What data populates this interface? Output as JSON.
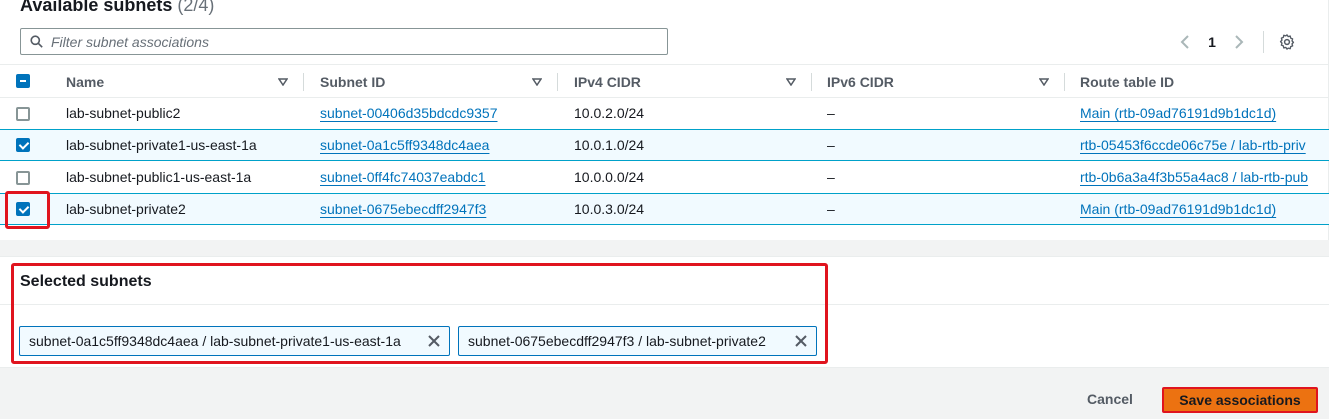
{
  "header": {
    "title": "Available subnets",
    "count": "(2/4)"
  },
  "filter": {
    "placeholder": "Filter subnet associations",
    "value": ""
  },
  "pagination": {
    "current_page": "1"
  },
  "columns": {
    "name": "Name",
    "subnet_id": "Subnet ID",
    "ipv4": "IPv4 CIDR",
    "ipv6": "IPv6 CIDR",
    "route_table": "Route table ID"
  },
  "rows": [
    {
      "name": "lab-subnet-public2",
      "subnet_id": "subnet-00406d35bdcdc9357",
      "ipv4": "10.0.2.0/24",
      "ipv6": "–",
      "route_table": "Main (rtb-09ad76191d9b1dc1d)",
      "selected": false
    },
    {
      "name": "lab-subnet-private1-us-east-1a",
      "subnet_id": "subnet-0a1c5ff9348dc4aea",
      "ipv4": "10.0.1.0/24",
      "ipv6": "–",
      "route_table": "rtb-05453f6ccde06c75e / lab-rtb-priv",
      "selected": true
    },
    {
      "name": "lab-subnet-public1-us-east-1a",
      "subnet_id": "subnet-0ff4fc74037eabdc1",
      "ipv4": "10.0.0.0/24",
      "ipv6": "–",
      "route_table": "rtb-0b6a3a4f3b55a4ac8 / lab-rtb-pub",
      "selected": false
    },
    {
      "name": "lab-subnet-private2",
      "subnet_id": "subnet-0675ebecdff2947f3",
      "ipv4": "10.0.3.0/24",
      "ipv6": "–",
      "route_table": "Main (rtb-09ad76191d9b1dc1d)",
      "selected": true
    }
  ],
  "selected_panel": {
    "title": "Selected subnets",
    "tokens": [
      "subnet-0a1c5ff9348dc4aea / lab-subnet-private1-us-east-1a",
      "subnet-0675ebecdff2947f3 / lab-subnet-private2"
    ]
  },
  "footer": {
    "cancel_label": "Cancel",
    "save_label": "Save associations"
  },
  "icons": {
    "search": "search-icon",
    "settings": "gear-icon",
    "sort": "sort-caret-icon",
    "remove": "close-icon"
  },
  "colors": {
    "link": "#0073bb",
    "primary_button": "#ec7211",
    "highlight": "#e0141e",
    "selected_row": "#f1faff"
  }
}
